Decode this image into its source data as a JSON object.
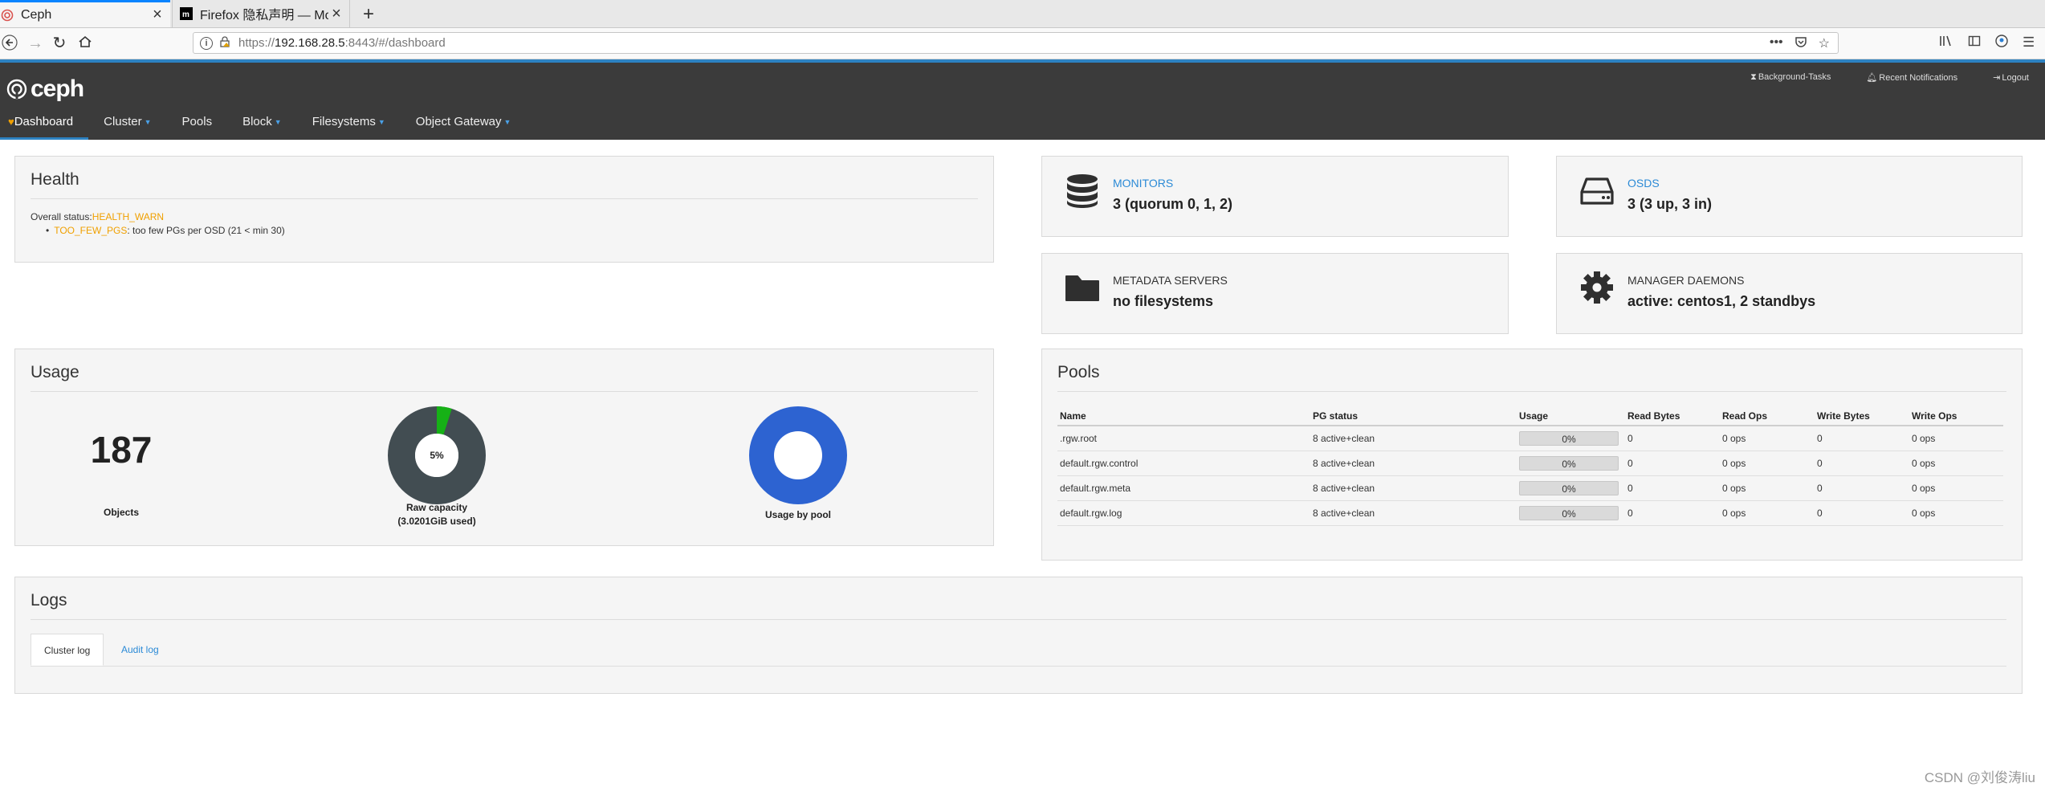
{
  "browser": {
    "tabs": [
      {
        "title": "Ceph",
        "active": true
      },
      {
        "title": "Firefox 隐私声明 — Mozilla",
        "active": false
      }
    ],
    "new_tab": "+",
    "close_glyph": "×",
    "url_prefix": "https://",
    "url_host": "192.168.28.5",
    "url_rest": ":8443/#/dashboard",
    "url_actions": [
      "•••",
      "☐",
      "☆"
    ]
  },
  "ceph": {
    "logo_text": "ceph",
    "utility": {
      "background_tasks": "Background-Tasks",
      "notifications": "Recent Notifications",
      "logout": "Logout"
    },
    "nav": [
      {
        "label": "Dashboard",
        "active": true,
        "dropdown": false
      },
      {
        "label": "Cluster",
        "active": false,
        "dropdown": true
      },
      {
        "label": "Pools",
        "active": false,
        "dropdown": false
      },
      {
        "label": "Block",
        "active": false,
        "dropdown": true
      },
      {
        "label": "Filesystems",
        "active": false,
        "dropdown": true
      },
      {
        "label": "Object Gateway",
        "active": false,
        "dropdown": true
      }
    ]
  },
  "health": {
    "title": "Health",
    "overall_label": "Overall status:",
    "overall_value": "HEALTH_WARN",
    "check_code": "TOO_FEW_PGS",
    "check_message": ": too few PGs per OSD (21 < min 30)"
  },
  "cards": {
    "monitors": {
      "label": "MONITORS",
      "value": "3 (quorum 0, 1, 2)",
      "icon": "database-icon"
    },
    "osds": {
      "label": "OSDS",
      "value": "3 (3 up, 3 in)",
      "icon": "hdd-icon"
    },
    "mds": {
      "label": "METADATA SERVERS",
      "value": "no filesystems",
      "icon": "folder-icon"
    },
    "mgr": {
      "label": "MANAGER DAEMONS",
      "value": "active: centos1, 2 standbys",
      "icon": "gear-icon"
    }
  },
  "usage": {
    "title": "Usage",
    "objects_count": "187",
    "objects_label": "Objects",
    "raw_capacity": {
      "percent_label": "5%",
      "used_fraction": 0.05,
      "label_line1": "Raw capacity",
      "label_line2": "(3.0201GiB used)",
      "colors": {
        "used": "#16b116",
        "free": "#424d52"
      }
    },
    "pool_usage": {
      "label": "Usage by pool",
      "color": "#2d63d1"
    }
  },
  "pools": {
    "title": "Pools",
    "columns": [
      "Name",
      "PG status",
      "Usage",
      "Read Bytes",
      "Read Ops",
      "Write Bytes",
      "Write Ops"
    ],
    "rows": [
      {
        "name": ".rgw.root",
        "pg_status": "8 active+clean",
        "usage": "0%",
        "read_bytes": "0",
        "read_ops": "0 ops",
        "write_bytes": "0",
        "write_ops": "0 ops"
      },
      {
        "name": "default.rgw.control",
        "pg_status": "8 active+clean",
        "usage": "0%",
        "read_bytes": "0",
        "read_ops": "0 ops",
        "write_bytes": "0",
        "write_ops": "0 ops"
      },
      {
        "name": "default.rgw.meta",
        "pg_status": "8 active+clean",
        "usage": "0%",
        "read_bytes": "0",
        "read_ops": "0 ops",
        "write_bytes": "0",
        "write_ops": "0 ops"
      },
      {
        "name": "default.rgw.log",
        "pg_status": "8 active+clean",
        "usage": "0%",
        "read_bytes": "0",
        "read_ops": "0 ops",
        "write_bytes": "0",
        "write_ops": "0 ops"
      }
    ]
  },
  "logs": {
    "title": "Logs",
    "tabs": [
      {
        "label": "Cluster log",
        "active": true
      },
      {
        "label": "Audit log",
        "active": false
      }
    ]
  },
  "watermark": "CSDN @刘俊涛liu"
}
